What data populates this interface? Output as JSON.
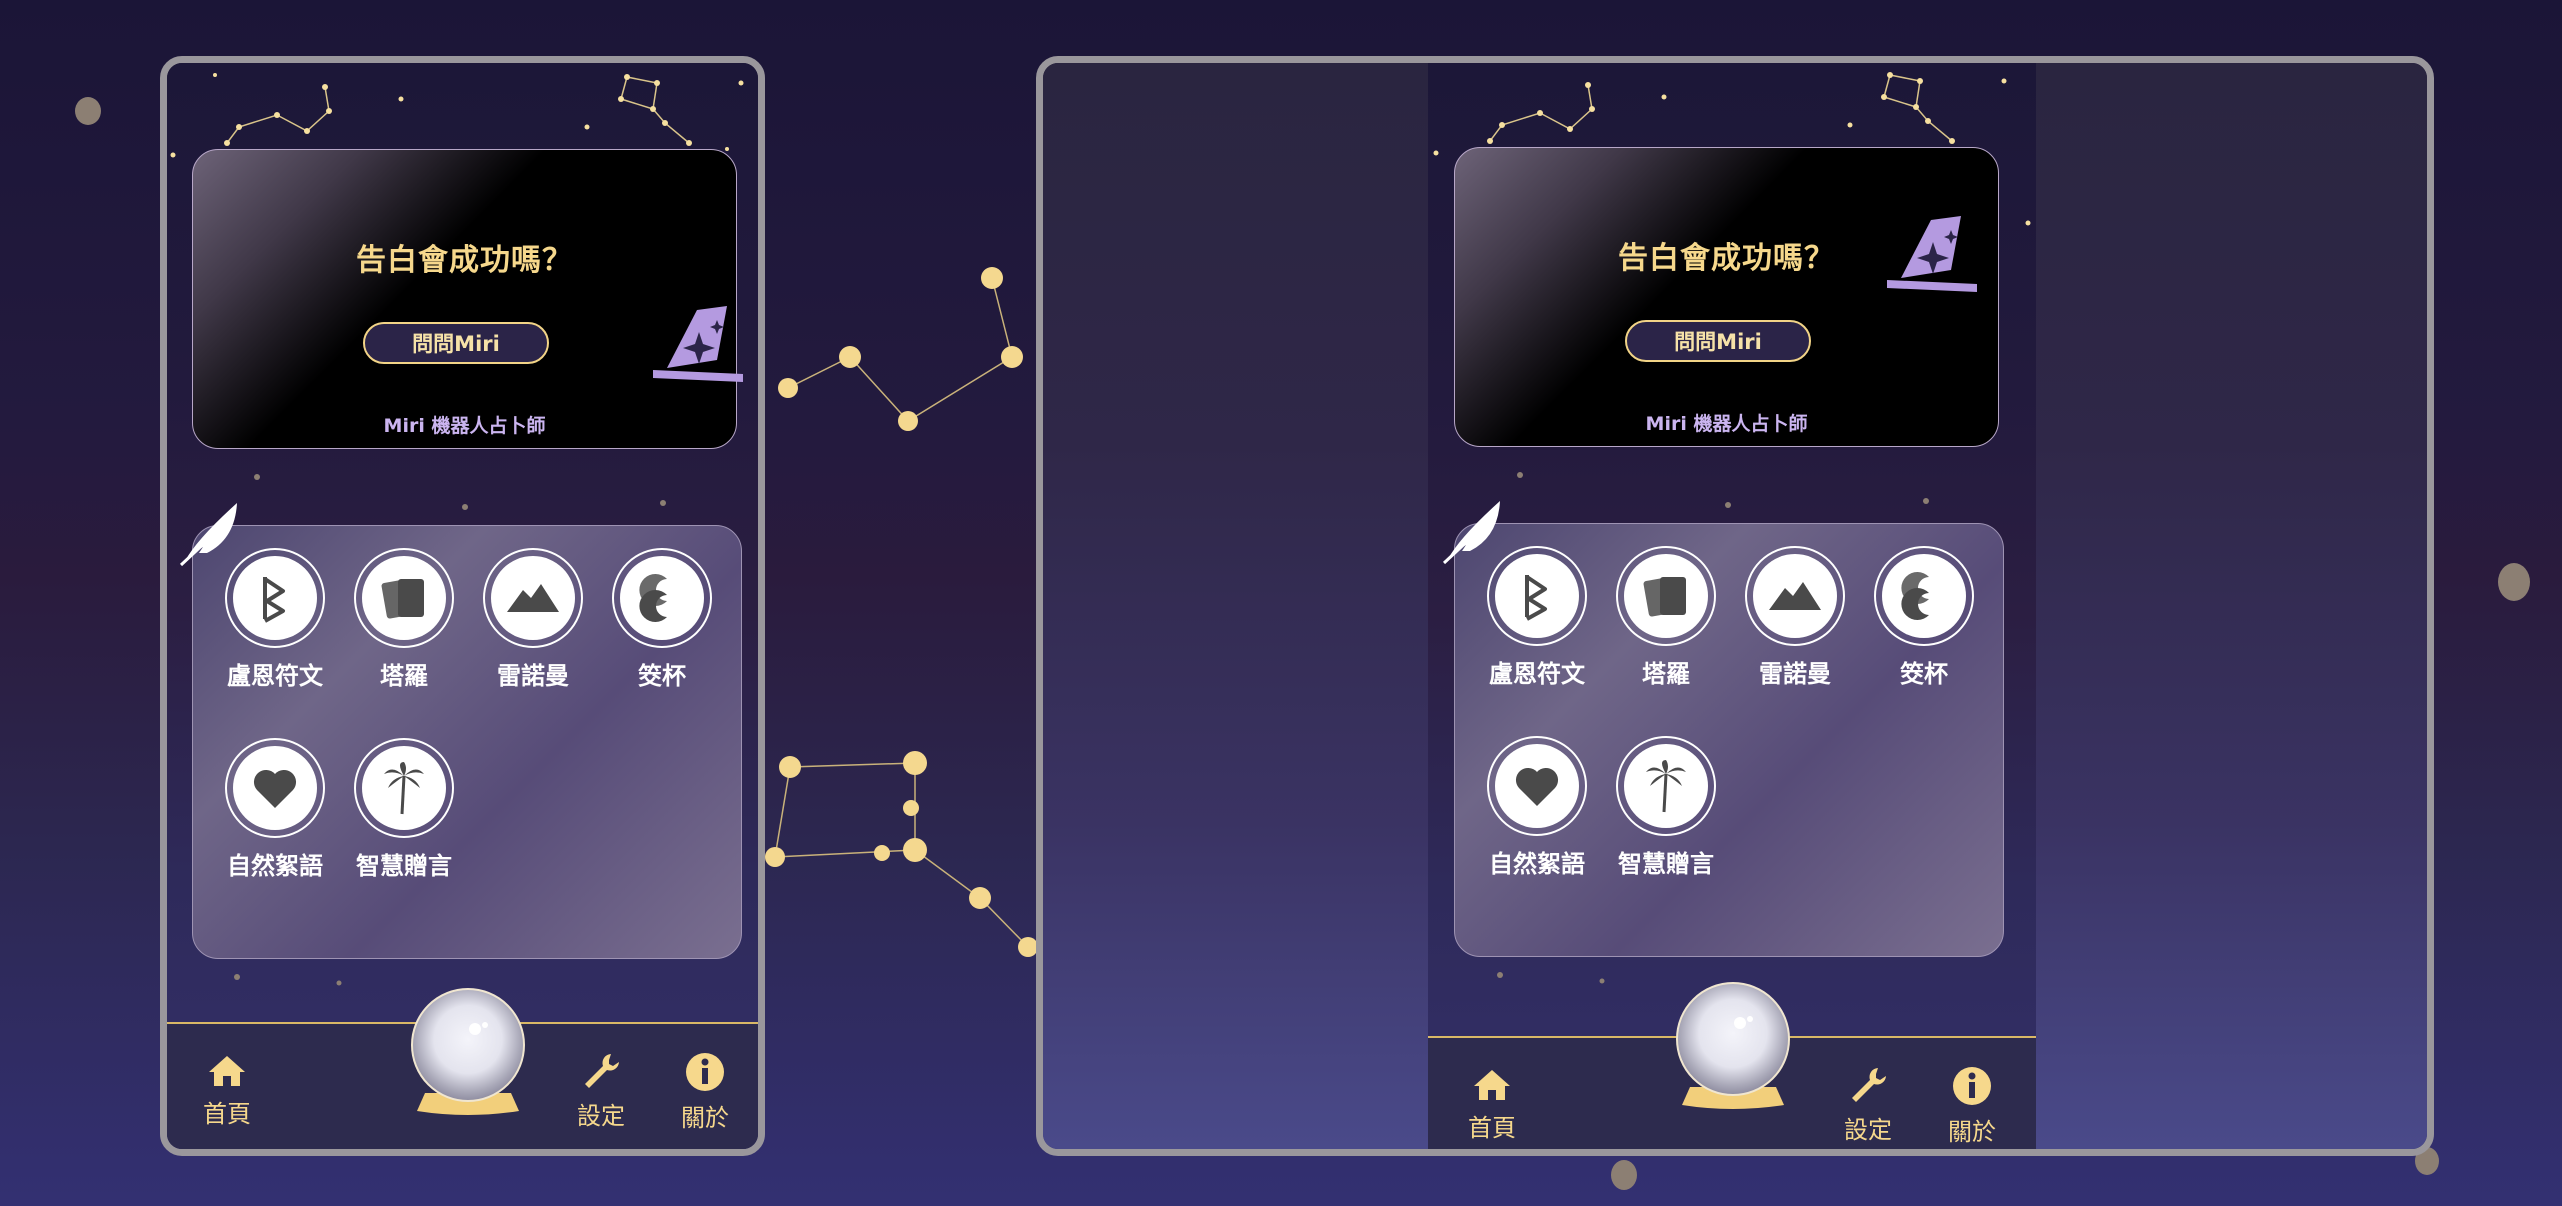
{
  "question": "告白會成功嗎？",
  "ask_button": "問問Miri",
  "fortune_teller": "Miri 機器人占卜師",
  "menu": [
    {
      "label": "盧恩符文",
      "icon": "rune-icon"
    },
    {
      "label": "塔羅",
      "icon": "tarot-cards-icon"
    },
    {
      "label": "雷諾曼",
      "icon": "mountain-icon"
    },
    {
      "label": "筊杯",
      "icon": "moon-blocks-icon"
    },
    {
      "label": "自然絮語",
      "icon": "heart-icon"
    },
    {
      "label": "智慧贈言",
      "icon": "palm-tree-icon"
    }
  ],
  "nav": {
    "home": "首頁",
    "settings": "設定",
    "about": "關於"
  },
  "colors": {
    "accent_gold": "#f6d88c",
    "hat_purple": "#b49ae0",
    "label_purple": "#cbb5f0"
  }
}
